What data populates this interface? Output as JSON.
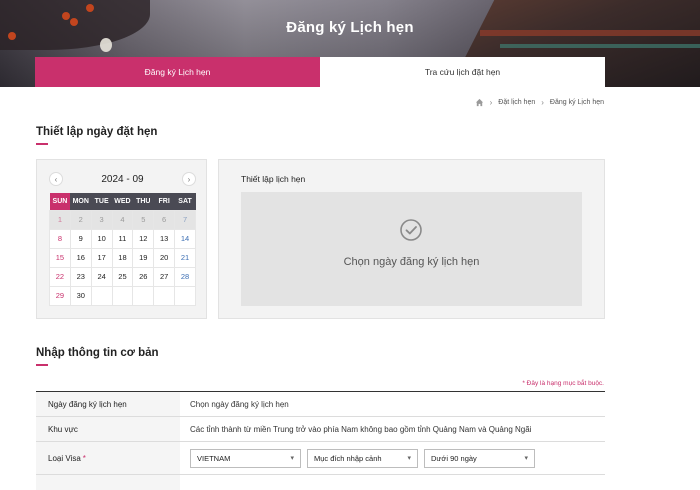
{
  "banner": {
    "title": "Đăng ký Lịch hẹn"
  },
  "tabs": {
    "active": "Đăng ký Lịch hẹn",
    "inactive": "Tra cứu lịch đặt hẹn"
  },
  "breadcrumb": {
    "items": [
      "Đặt lịch hẹn",
      "Đăng ký Lịch hẹn"
    ]
  },
  "section1": {
    "title": "Thiết lập ngày đặt hẹn"
  },
  "calendar": {
    "month": "2024 - 09",
    "days": [
      "SUN",
      "MON",
      "TUE",
      "WED",
      "THU",
      "FRI",
      "SAT"
    ],
    "weeks": [
      [
        [
          "1",
          "past sunc"
        ],
        [
          "2",
          "past"
        ],
        [
          "3",
          "past"
        ],
        [
          "4",
          "past"
        ],
        [
          "5",
          "past"
        ],
        [
          "6",
          "past"
        ],
        [
          "7",
          "past satc"
        ]
      ],
      [
        [
          "8",
          "sunc"
        ],
        [
          "9",
          ""
        ],
        [
          "10",
          ""
        ],
        [
          "11",
          ""
        ],
        [
          "12",
          ""
        ],
        [
          "13",
          ""
        ],
        [
          "14",
          "satc"
        ]
      ],
      [
        [
          "15",
          "sunc"
        ],
        [
          "16",
          ""
        ],
        [
          "17",
          ""
        ],
        [
          "18",
          ""
        ],
        [
          "19",
          ""
        ],
        [
          "20",
          ""
        ],
        [
          "21",
          "satc"
        ]
      ],
      [
        [
          "22",
          "sunc"
        ],
        [
          "23",
          ""
        ],
        [
          "24",
          ""
        ],
        [
          "25",
          ""
        ],
        [
          "26",
          ""
        ],
        [
          "27",
          ""
        ],
        [
          "28",
          "satc"
        ]
      ],
      [
        [
          "29",
          "sunc"
        ],
        [
          "30",
          ""
        ],
        [
          "",
          "empty"
        ],
        [
          "",
          "empty"
        ],
        [
          "",
          "empty"
        ],
        [
          "",
          "empty"
        ],
        [
          "",
          "empty"
        ]
      ]
    ]
  },
  "time_panel": {
    "title": "Thiết lập lịch hẹn",
    "message": "Chọn ngày đăng ký lịch hẹn"
  },
  "section2": {
    "title": "Nhập thông tin cơ bản"
  },
  "form": {
    "required_note": "* Đây là hạng mục bắt buộc.",
    "rows": [
      {
        "label": "Ngày đăng ký lịch hẹn",
        "value": "Chọn ngày đăng ký lịch hẹn"
      },
      {
        "label": "Khu vực",
        "value": "Các tỉnh thành từ miền Trung trở vào phía Nam không bao gồm tỉnh Quảng Nam và Quảng Ngãi"
      },
      {
        "label": "Loại Visa",
        "required": "*"
      }
    ],
    "visa_selects": [
      "VIETNAM",
      "Mục đích nhập cảnh",
      "Dưới 90 ngày"
    ]
  },
  "colors": {
    "accent": "#c9306c",
    "header_dark": "#4a4a54"
  },
  "icons": {
    "home": "home-icon",
    "check": "check-circle-icon",
    "prev": "chevron-left-icon",
    "next": "chevron-right-icon"
  }
}
